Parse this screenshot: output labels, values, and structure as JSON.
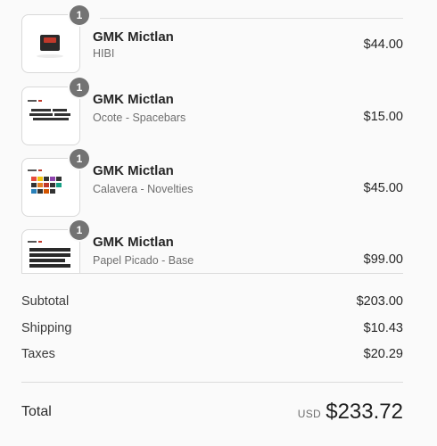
{
  "line_items": [
    {
      "quantity": "1",
      "name": "GMK Mictlan",
      "variant": "HIBI",
      "price": "$44.00",
      "thumbnail_icon": "keycap-product-image"
    },
    {
      "quantity": "1",
      "name": "GMK Mictlan",
      "variant": "Ocote - Spacebars",
      "price": "$15.00",
      "thumbnail_icon": "spacebar-kit-image"
    },
    {
      "quantity": "1",
      "name": "GMK Mictlan",
      "variant": "Calavera - Novelties",
      "price": "$45.00",
      "thumbnail_icon": "novelties-kit-image"
    },
    {
      "quantity": "1",
      "name": "GMK Mictlan",
      "variant": "Papel Picado - Base",
      "price": "$99.00",
      "thumbnail_icon": "base-kit-image"
    }
  ],
  "summary": {
    "subtotal_label": "Subtotal",
    "subtotal_value": "$203.00",
    "shipping_label": "Shipping",
    "shipping_value": "$10.43",
    "taxes_label": "Taxes",
    "taxes_value": "$20.29"
  },
  "total": {
    "label": "Total",
    "currency": "USD",
    "value": "$233.72"
  },
  "colors": {
    "badge": "#737373",
    "background": "#fafafa",
    "divider": "#dcdcdc"
  }
}
